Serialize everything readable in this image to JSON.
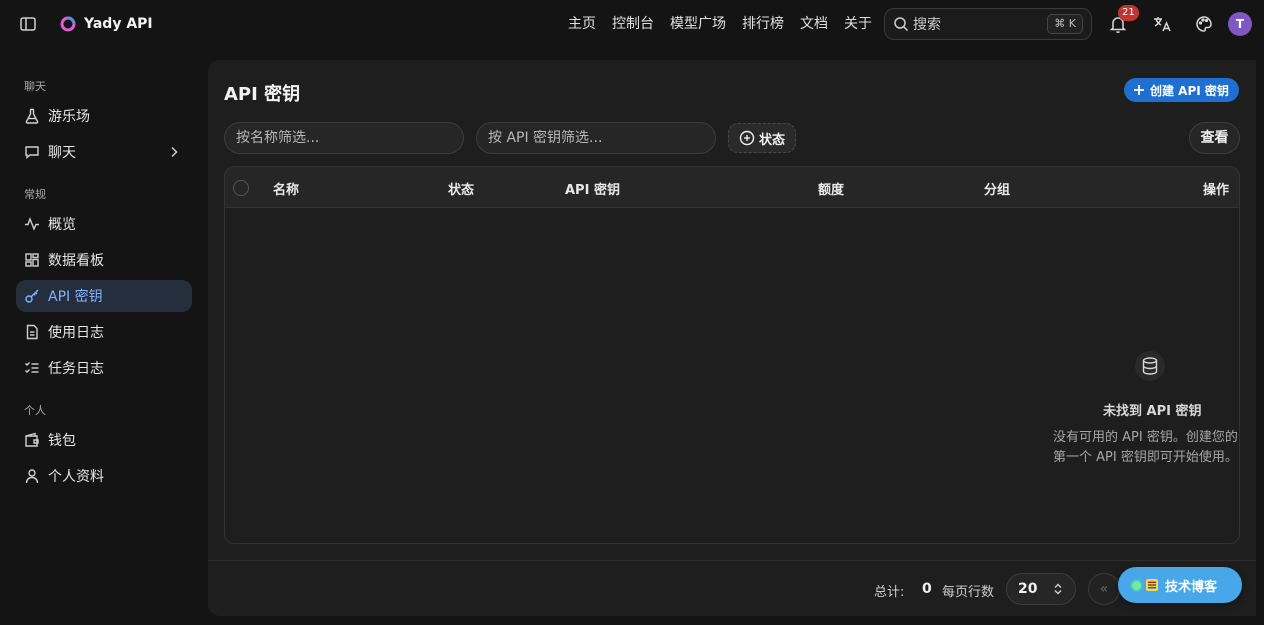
{
  "header": {
    "app_title": "Yady API",
    "nav": [
      "主页",
      "控制台",
      "模型广场",
      "排行榜",
      "文档",
      "关于"
    ],
    "search_placeholder": "搜索",
    "search_shortcut": "⌘ K",
    "notification_count": "21",
    "avatar_letter": "T"
  },
  "sidebar": {
    "sections": [
      {
        "title": "聊天",
        "items": [
          {
            "label": "游乐场",
            "icon": "flask-icon"
          },
          {
            "label": "聊天",
            "icon": "message-icon",
            "expandable": true
          }
        ]
      },
      {
        "title": "常规",
        "items": [
          {
            "label": "概览",
            "icon": "activity-icon"
          },
          {
            "label": "数据看板",
            "icon": "dashboard-icon"
          },
          {
            "label": "API 密钥",
            "icon": "key-icon",
            "active": true
          },
          {
            "label": "使用日志",
            "icon": "file-icon"
          },
          {
            "label": "任务日志",
            "icon": "list-check-icon"
          }
        ]
      },
      {
        "title": "个人",
        "items": [
          {
            "label": "钱包",
            "icon": "wallet-icon"
          },
          {
            "label": "个人资料",
            "icon": "user-icon"
          }
        ]
      }
    ]
  },
  "main": {
    "title": "API 密钥",
    "create_button": "创建 API 密钥",
    "filter_name_placeholder": "按名称筛选...",
    "filter_key_placeholder": "按 API 密钥筛选...",
    "status_button": "状态",
    "view_button": "查看",
    "columns": [
      "名称",
      "状态",
      "API 密钥",
      "额度",
      "分组",
      "操作"
    ],
    "empty": {
      "title": "未找到 API 密钥",
      "line1": "没有可用的 API 密钥。创建您的",
      "line2": "第一个 API 密钥即可开始使用。"
    },
    "footer": {
      "total_label": "总计:",
      "total_value": "0",
      "rows_label": "每页行数",
      "rows_value": "20",
      "first_page": "«"
    }
  },
  "floating": {
    "blog_label": "技术博客"
  },
  "colors": {
    "accent": "#1f6fd1",
    "active_bg": "#242e3d",
    "active_text": "#7fb3ff",
    "badge": "#c23434",
    "blog": "#47a7e8"
  }
}
